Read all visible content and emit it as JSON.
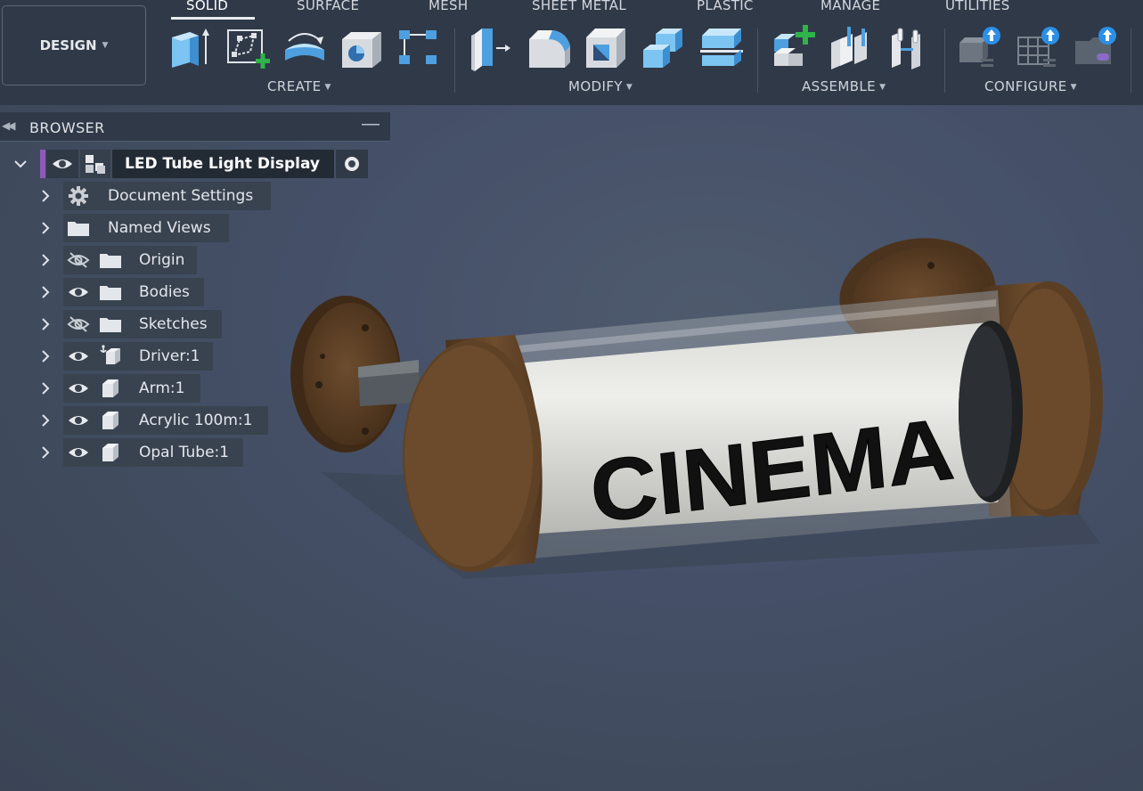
{
  "workspace": {
    "label": "DESIGN"
  },
  "tabs": [
    {
      "label": "SOLID",
      "active": true
    },
    {
      "label": "SURFACE"
    },
    {
      "label": "MESH"
    },
    {
      "label": "SHEET METAL"
    },
    {
      "label": "PLASTIC"
    },
    {
      "label": "MANAGE"
    },
    {
      "label": "UTILITIES"
    }
  ],
  "groups": {
    "create": "CREATE",
    "modify": "MODIFY",
    "assemble": "ASSEMBLE",
    "configure": "CONFIGURE"
  },
  "browser": {
    "title": "BROWSER",
    "root": {
      "label": "LED Tube Light Display"
    },
    "items": [
      {
        "label": "Document Settings",
        "icon": "gear-icon"
      },
      {
        "label": "Named Views",
        "icon": "folder-icon"
      },
      {
        "label": "Origin",
        "visibility": "hidden"
      },
      {
        "label": "Bodies",
        "visibility": "visible"
      },
      {
        "label": "Sketches",
        "visibility": "hidden"
      },
      {
        "label": "Driver:1",
        "visibility": "visible",
        "icon": "grounded-component-icon"
      },
      {
        "label": "Arm:1",
        "visibility": "visible",
        "icon": "component-icon"
      },
      {
        "label": "Acrylic 100m:1",
        "visibility": "visible",
        "icon": "component-icon"
      },
      {
        "label": "Opal Tube:1",
        "visibility": "visible",
        "icon": "component-icon"
      }
    ]
  },
  "model": {
    "text": "CINEMA"
  },
  "colors": {
    "toolbar_bg": "#2f3948",
    "accent_blue": "#4aa3e6",
    "green_plus": "#2fb34a",
    "bronze": "#6b4a2b",
    "root_marker": "#8d5ab8"
  }
}
